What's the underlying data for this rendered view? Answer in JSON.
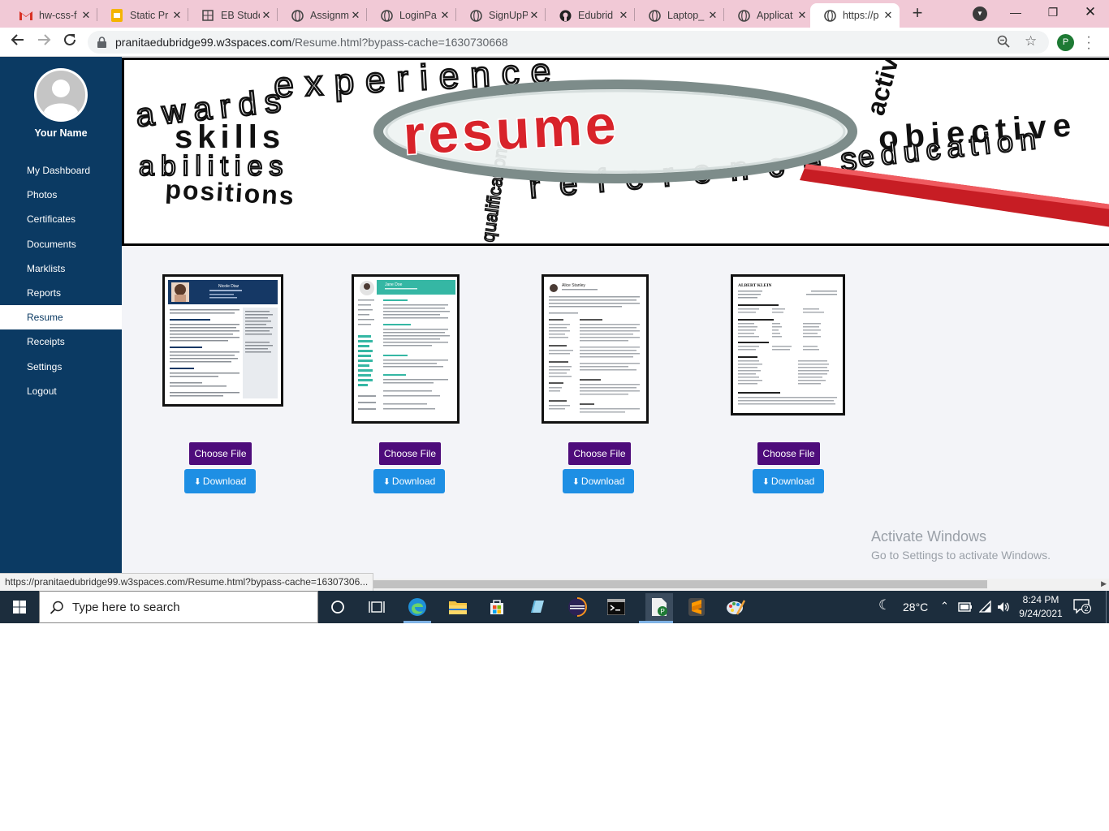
{
  "browser": {
    "tabs": [
      {
        "title": "hw-css-f",
        "icon": "gmail-icon"
      },
      {
        "title": "Static Pr",
        "icon": "slides-icon"
      },
      {
        "title": "EB Stude",
        "icon": "grid-icon"
      },
      {
        "title": "Assignm",
        "icon": "globe-icon"
      },
      {
        "title": "LoginPa",
        "icon": "globe-icon"
      },
      {
        "title": "SignUpP",
        "icon": "globe-icon"
      },
      {
        "title": "Edubrid",
        "icon": "github-icon"
      },
      {
        "title": "Laptop_",
        "icon": "globe-icon"
      },
      {
        "title": "Applicat",
        "icon": "globe-icon"
      },
      {
        "title": "https://p",
        "icon": "globe-icon",
        "active": true
      }
    ],
    "url_host": "pranitaedubridge99.w3spaces.com",
    "url_rest": "/Resume.html?bypass-cache=1630730668",
    "profile_initial": "P",
    "status_url": "https://pranitaedubridge99.w3spaces.com/Resume.html?bypass-cache=16307306..."
  },
  "sidebar": {
    "user_name": "Your Name",
    "items": [
      {
        "label": "My Dashboard"
      },
      {
        "label": "Photos"
      },
      {
        "label": "Certificates"
      },
      {
        "label": "Documents"
      },
      {
        "label": "Marklists"
      },
      {
        "label": "Reports"
      },
      {
        "label": "Resume",
        "active": true
      },
      {
        "label": "Receipts"
      },
      {
        "label": "Settings"
      },
      {
        "label": "Logout"
      }
    ]
  },
  "banner": {
    "words": [
      "experience",
      "awards",
      "skills",
      "resume",
      "abilities",
      "positions",
      "references",
      "objective",
      "education",
      "activities",
      "qualifications"
    ]
  },
  "resumes": [
    {
      "choose_label": "Choose File",
      "download_label": "Download",
      "sample_name": "Nicole Diaz"
    },
    {
      "choose_label": "Choose File",
      "download_label": "Download",
      "sample_name": "Jane Doe"
    },
    {
      "choose_label": "Choose File",
      "download_label": "Download",
      "sample_name": "Alice Stanley"
    },
    {
      "choose_label": "Choose File",
      "download_label": "Download",
      "sample_name": "ALBERT KLEIN"
    }
  ],
  "watermark": {
    "line1": "Activate Windows",
    "line2": "Go to Settings to activate Windows."
  },
  "taskbar": {
    "search_placeholder": "Type here to search",
    "temperature": "28°C",
    "time": "8:24 PM",
    "date": "9/24/2021",
    "notification_count": "2"
  },
  "colors": {
    "tab_strip": "#f1c9d6",
    "sidebar": "#0b3a63",
    "choose_button": "#4e0c7b",
    "download_button": "#1e8fe4",
    "banner_red": "#d8232a",
    "taskbar": "#1c2d3d"
  }
}
